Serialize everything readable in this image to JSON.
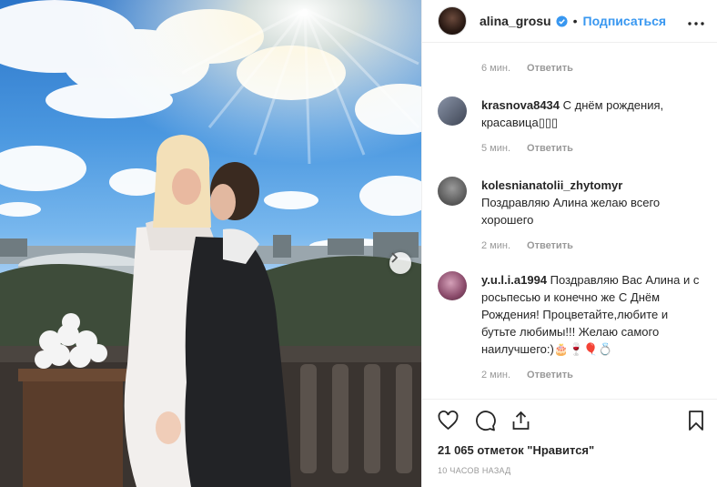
{
  "post": {
    "username": "alina_grosu",
    "separator": "•",
    "follow_label": "Подписаться",
    "more_label": "•••"
  },
  "comments": [
    {
      "user": "",
      "text": "",
      "time": "6 мин.",
      "reply_label": "Ответить"
    },
    {
      "user": "krasnova8434",
      "text": "С днём рождения, красавица▯▯▯",
      "time": "5 мин.",
      "reply_label": "Ответить"
    },
    {
      "user": "kolesnianatolii_zhytomyr",
      "text": "Поздравляю Алина желаю всего хорошего",
      "time": "2 мин.",
      "reply_label": "Ответить"
    },
    {
      "user": "y.u.l.i.a1994",
      "text": "Поздравляю Вас Алина и с росьпесью и конечно же С Днём Рождения! Процветайте,любите и бутьте любимы!!! Желаю самого наилучшего:)🎂🍷🎈💍",
      "time": "2 мин.",
      "reply_label": "Ответить"
    }
  ],
  "footer": {
    "likes": "21 065 отметок \"Нравится\"",
    "time": "10 ЧАСОВ НАЗАД"
  },
  "icons": {
    "like": "heart-icon",
    "comment": "comment-icon",
    "share": "share-icon",
    "save": "bookmark-icon",
    "verified": "verified-badge-icon",
    "next": "chevron-right-icon"
  },
  "colors": {
    "link": "#3897f0",
    "muted": "#999999",
    "text": "#262626"
  }
}
